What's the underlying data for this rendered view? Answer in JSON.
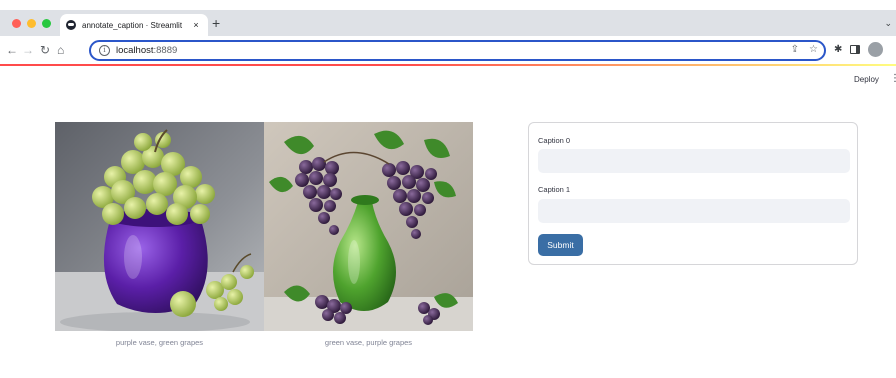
{
  "browser": {
    "tab_title": "annotate_caption · Streamlit",
    "tab_close": "×",
    "new_tab": "+",
    "url_host": "localhost",
    "url_port": ":8889"
  },
  "app": {
    "deploy_label": "Deploy"
  },
  "images": [
    {
      "caption": "purple vase, green grapes",
      "vase_color": "#5b1fa8",
      "grape_color": "#b7d06a"
    },
    {
      "caption": "green vase, purple grapes",
      "vase_color": "#4fa32e",
      "grape_color": "#3e2550"
    }
  ],
  "form": {
    "fields": [
      {
        "label": "Caption 0",
        "value": "",
        "placeholder": ""
      },
      {
        "label": "Caption 1",
        "value": "",
        "placeholder": ""
      }
    ],
    "submit_label": "Submit",
    "accent_color": "#3a6ea5"
  }
}
